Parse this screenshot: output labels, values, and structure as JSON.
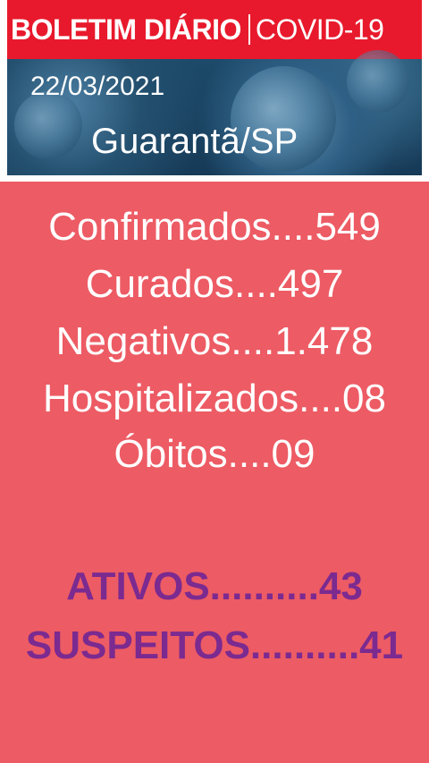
{
  "banner": {
    "title_main": "BOLETIM DIÁRIO",
    "title_sub": "COVID-19",
    "date": "22/03/2021",
    "city": "Guarantã/SP"
  },
  "stats": [
    {
      "label": "Confirmados....549"
    },
    {
      "label": "Curados....497"
    },
    {
      "label": "Negativos....1.478"
    },
    {
      "label": "Hospitalizados....08"
    },
    {
      "label": "Óbitos....09"
    }
  ],
  "active": [
    {
      "label": "ATIVOS..........43"
    },
    {
      "label": "SUSPEITOS..........41"
    }
  ],
  "colors": {
    "title_bar": "#e8192c",
    "panel": "#ed5b64",
    "active_text": "#7b2a90"
  }
}
